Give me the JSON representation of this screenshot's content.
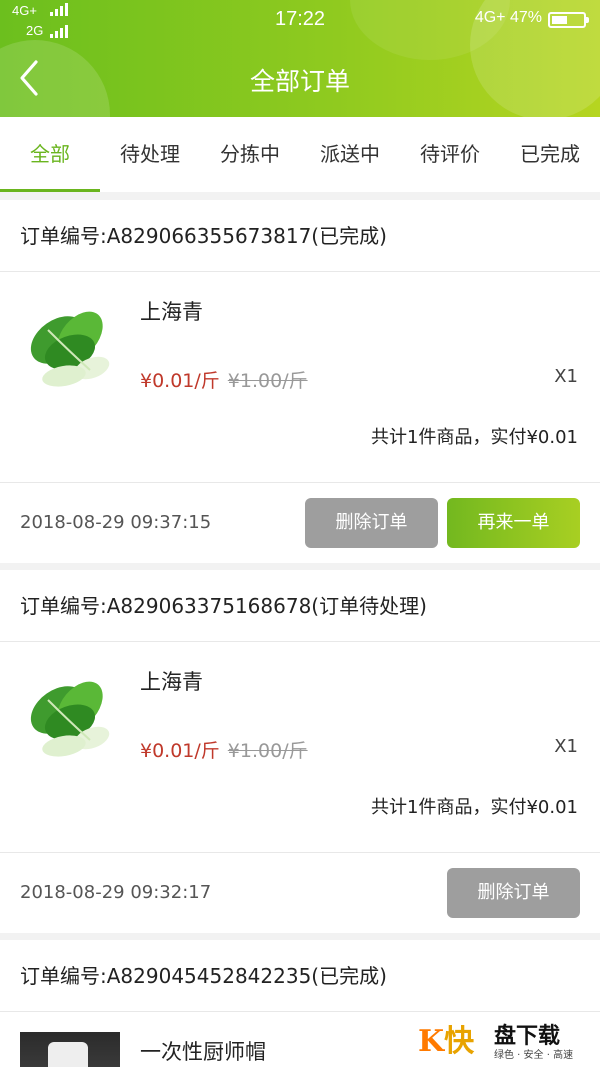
{
  "status_bar": {
    "network1": "4G+",
    "network2": "2G",
    "time": "17:22",
    "network_right": "4G+",
    "battery": "47%"
  },
  "header": {
    "title": "全部订单",
    "back_icon": "chevron-left-icon"
  },
  "tabs": [
    {
      "label": "全部",
      "active": true
    },
    {
      "label": "待处理"
    },
    {
      "label": "分拣中"
    },
    {
      "label": "派送中"
    },
    {
      "label": "待评价"
    },
    {
      "label": "已完成"
    }
  ],
  "colors": {
    "accent": "#6ab51e",
    "price": "#c0392b",
    "gray_button": "#9e9e9e"
  },
  "orders": [
    {
      "order_no": "订单编号:A829066355673817(已完成)",
      "product": {
        "name": "上海青",
        "price": "¥0.01/斤",
        "original_price": "¥1.00/斤",
        "qty": "X1",
        "image": "bok-choy-image"
      },
      "summary": "共计1件商品，实付¥0.01",
      "time": "2018-08-29 09:37:15",
      "buttons": {
        "delete": "删除订单",
        "reorder": "再来一单"
      }
    },
    {
      "order_no": "订单编号:A829063375168678(订单待处理)",
      "product": {
        "name": "上海青",
        "price": "¥0.01/斤",
        "original_price": "¥1.00/斤",
        "qty": "X1",
        "image": "bok-choy-image"
      },
      "summary": "共计1件商品，实付¥0.01",
      "time": "2018-08-29 09:32:17",
      "buttons": {
        "delete": "删除订单"
      }
    },
    {
      "order_no": "订单编号:A829045452842235(已完成)",
      "product": {
        "name": "一次性厨师帽",
        "image": "chef-hat-image"
      }
    }
  ],
  "watermark": {
    "logo": "K快",
    "title": "盘下载",
    "subtitle": "绿色 · 安全 · 高速"
  }
}
